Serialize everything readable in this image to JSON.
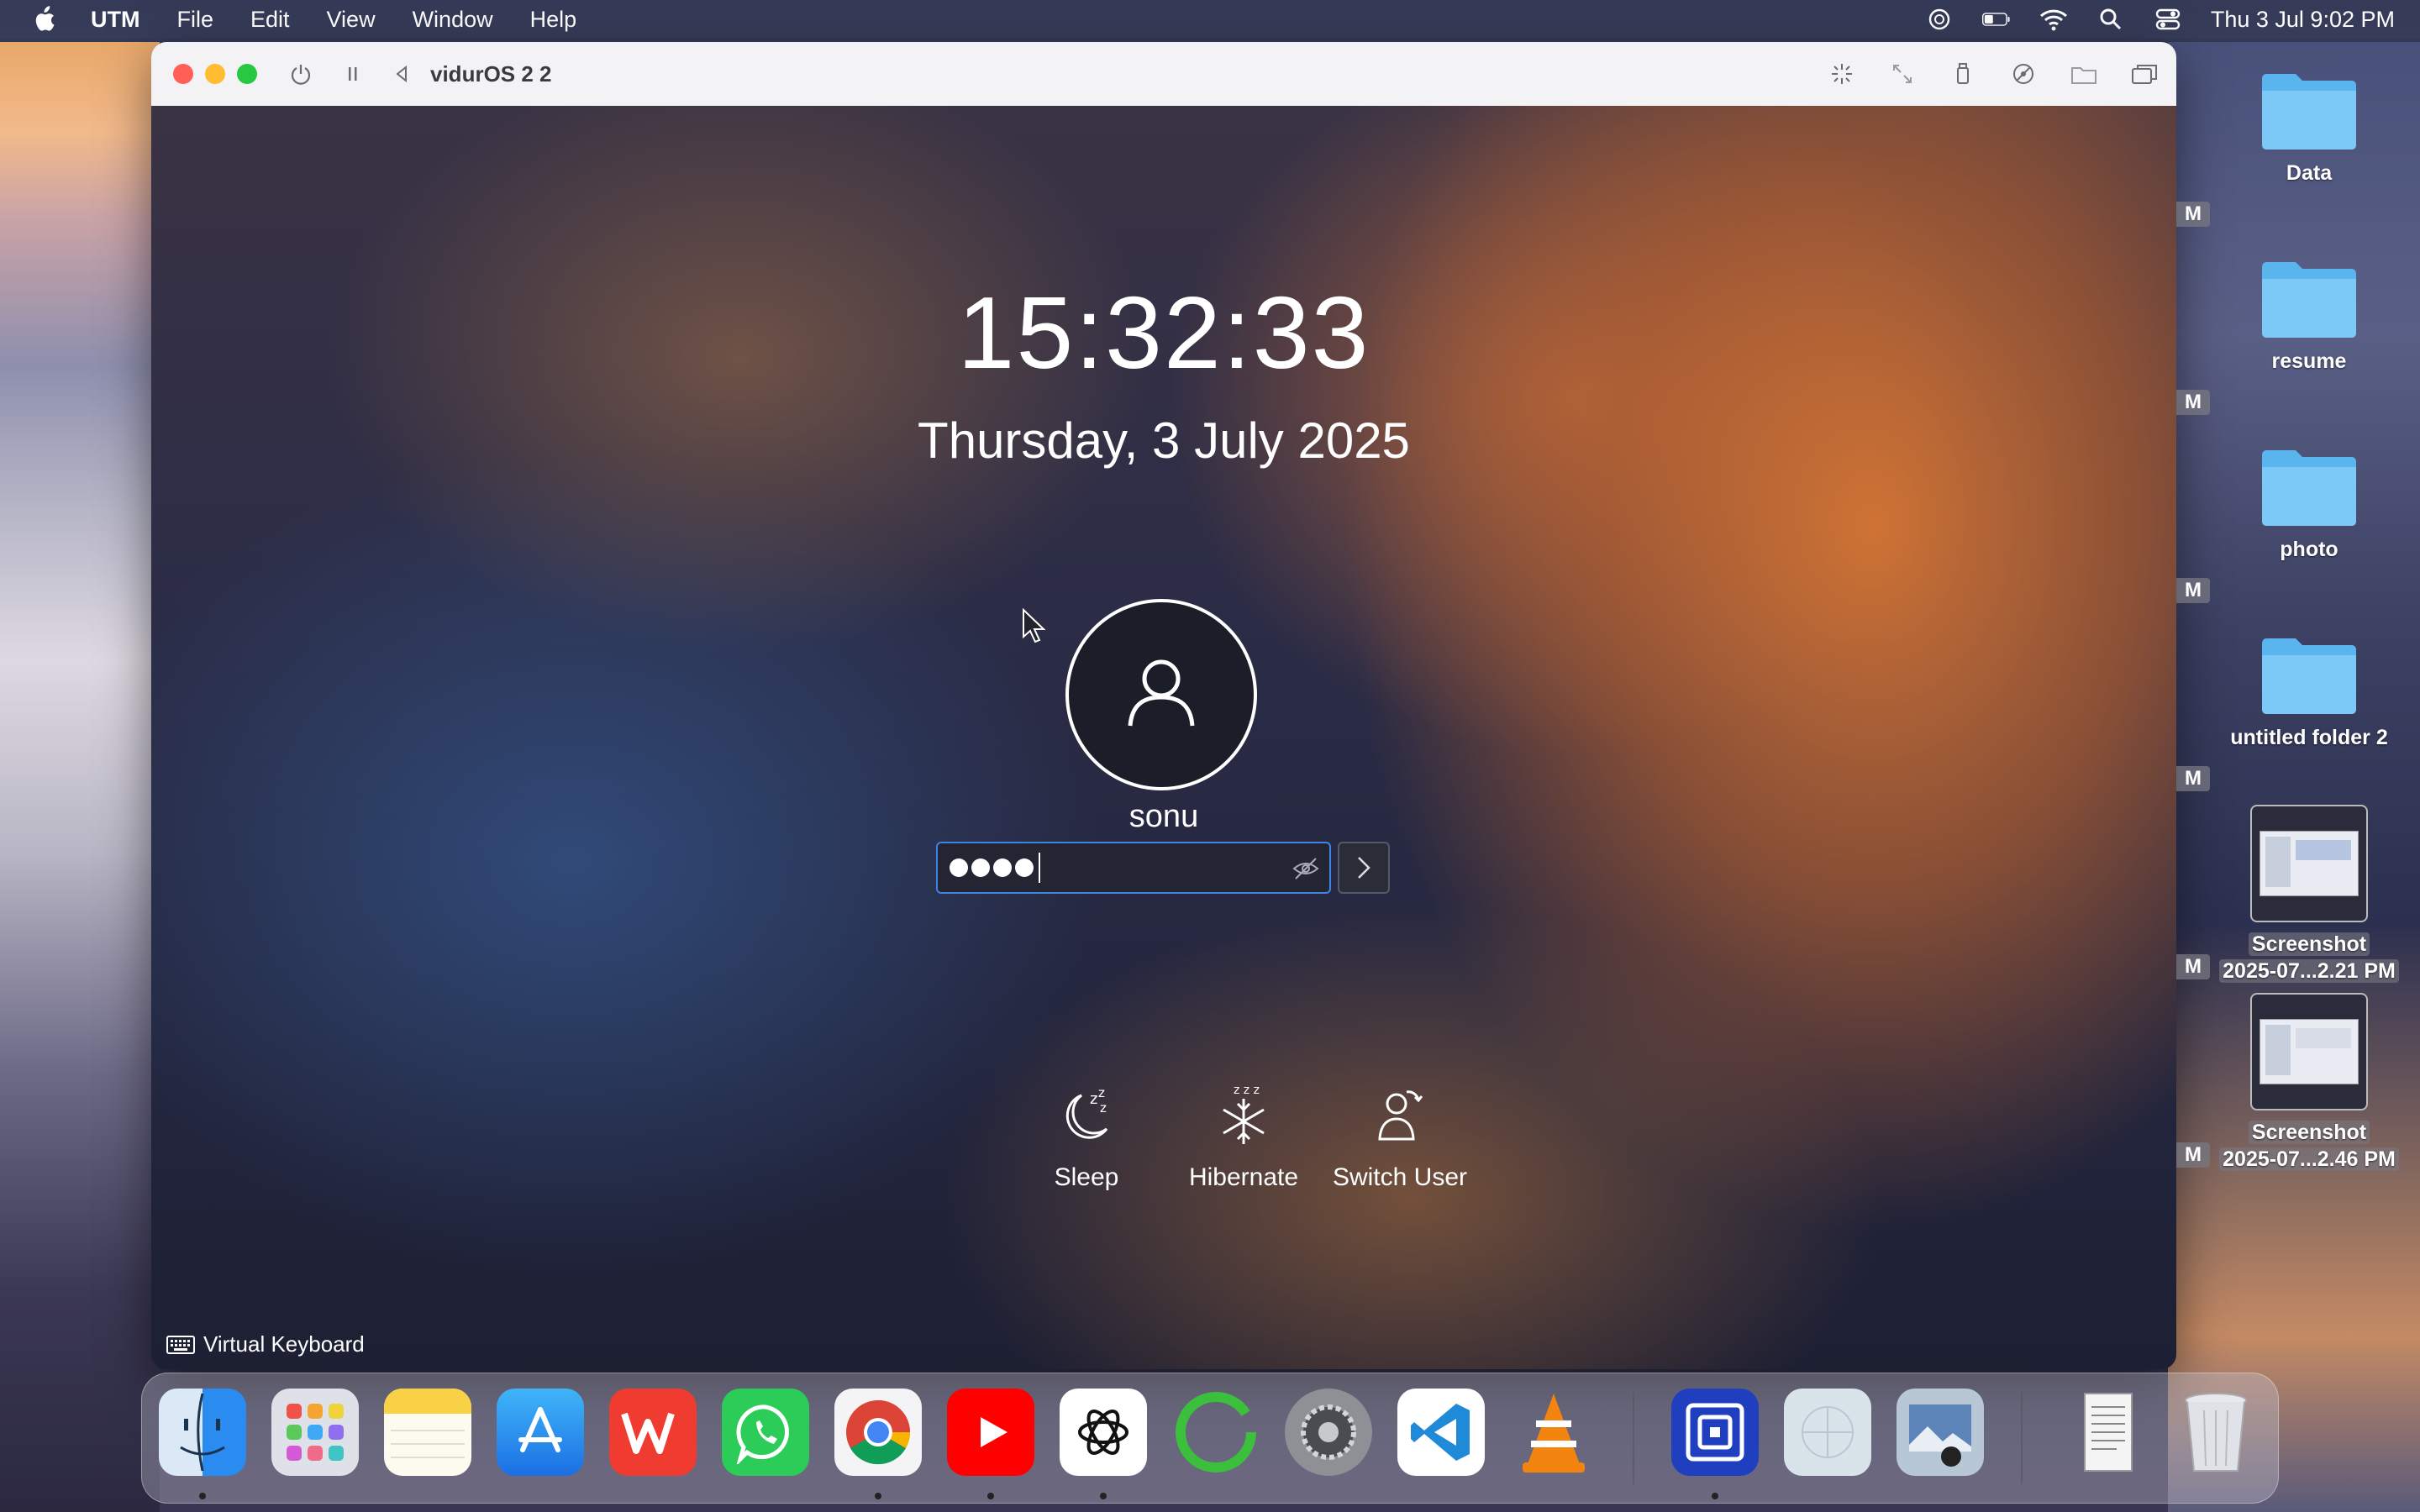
{
  "menubar": {
    "app_name": "UTM",
    "items": [
      "File",
      "Edit",
      "View",
      "Window",
      "Help"
    ],
    "datetime": "Thu 3 Jul  9:02 PM"
  },
  "window": {
    "title": "vidurOS 2 2"
  },
  "lockscreen": {
    "time": "15:32:33",
    "date": "Thursday, 3 July 2025",
    "username": "sonu",
    "password_masked_length": 4,
    "actions": [
      {
        "label": "Sleep",
        "icon": "sleep-icon"
      },
      {
        "label": "Hibernate",
        "icon": "hibernate-icon"
      },
      {
        "label": "Switch User",
        "icon": "switch-user-icon"
      }
    ],
    "virtual_keyboard": "Virtual Keyboard"
  },
  "desktop": {
    "items": [
      {
        "label": "Data",
        "type": "folder"
      },
      {
        "label": "resume",
        "type": "folder"
      },
      {
        "label": "photo",
        "type": "folder"
      },
      {
        "label": "untitled folder 2",
        "type": "folder"
      },
      {
        "label_line1": "Screenshot",
        "label_line2": "2025-07...2.21 PM",
        "type": "screenshot"
      },
      {
        "label_line1": "Screenshot",
        "label_line2": "2025-07...2.46 PM",
        "type": "screenshot"
      }
    ],
    "edge_chips": [
      "M",
      "M",
      "M",
      "M",
      "M",
      "M"
    ]
  },
  "dock": {
    "apps": [
      "Finder",
      "Launchpad",
      "Notes",
      "App Store",
      "WPS Office",
      "WhatsApp",
      "Google Chrome",
      "YouTube",
      "ChatGPT",
      "Activity Ring",
      "System Settings",
      "Visual Studio Code",
      "VLC",
      "UTM",
      "Preview",
      "Image Viewer",
      "Document",
      "Trash"
    ]
  },
  "colors": {
    "accent": "#3d84e6",
    "close": "#ff5f57",
    "minimize": "#febc2e",
    "zoom": "#28c840"
  }
}
